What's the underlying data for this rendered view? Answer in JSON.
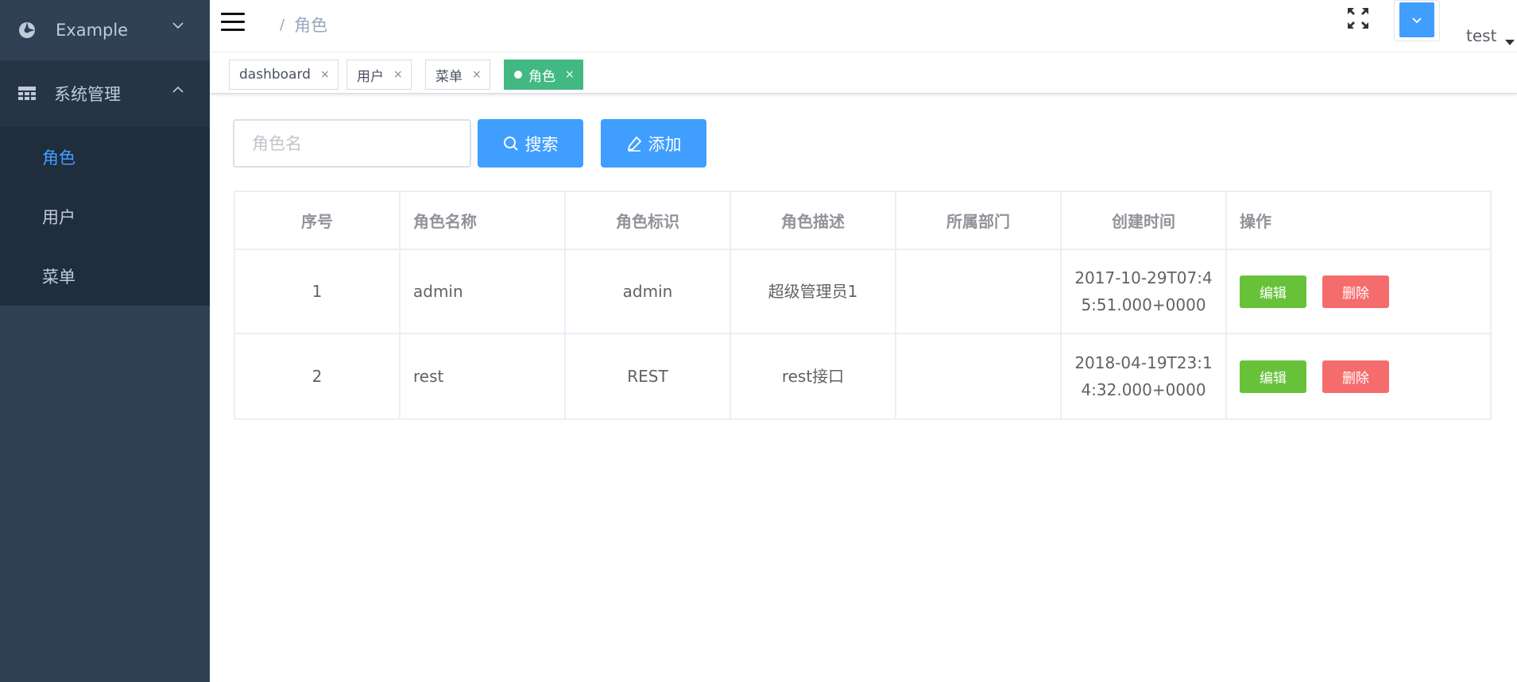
{
  "sidebar": {
    "brand": "Example",
    "group": "系统管理",
    "items": [
      {
        "label": "角色",
        "active": true
      },
      {
        "label": "用户",
        "active": false
      },
      {
        "label": "菜单",
        "active": false
      }
    ]
  },
  "navbar": {
    "breadcrumb_sep": "/",
    "breadcrumb": "角色",
    "user": "test"
  },
  "tags": [
    {
      "label": "dashboard",
      "close": "×"
    },
    {
      "label": "用户",
      "close": "×"
    },
    {
      "label": "菜单",
      "close": "×"
    },
    {
      "label": "角色",
      "close": "×",
      "active": true
    }
  ],
  "search": {
    "placeholder": "角色名",
    "search_label": "搜索",
    "add_label": "添加"
  },
  "table": {
    "headers": [
      "序号",
      "角色名称",
      "角色标识",
      "角色描述",
      "所属部门",
      "创建时间",
      "操作"
    ],
    "rows": [
      {
        "no": "1",
        "name": "admin",
        "key": "admin",
        "desc": "超级管理员1",
        "dept": "",
        "created_1": "2017-10-29T07:4",
        "created_2": "5:51.000+0000",
        "edit": "编辑",
        "delete": "删除"
      },
      {
        "no": "2",
        "name": "rest",
        "key": "REST",
        "desc": "rest接口",
        "dept": "",
        "created_1": "2018-04-19T23:1",
        "created_2": "4:32.000+0000",
        "edit": "编辑",
        "delete": "删除"
      }
    ]
  },
  "colors": {
    "sidebar_bg": "#304156",
    "sidebar_active": "#409eff",
    "primary": "#409eff",
    "tag_active": "#42b983",
    "success": "#67c23a",
    "danger": "#f56c6c"
  }
}
